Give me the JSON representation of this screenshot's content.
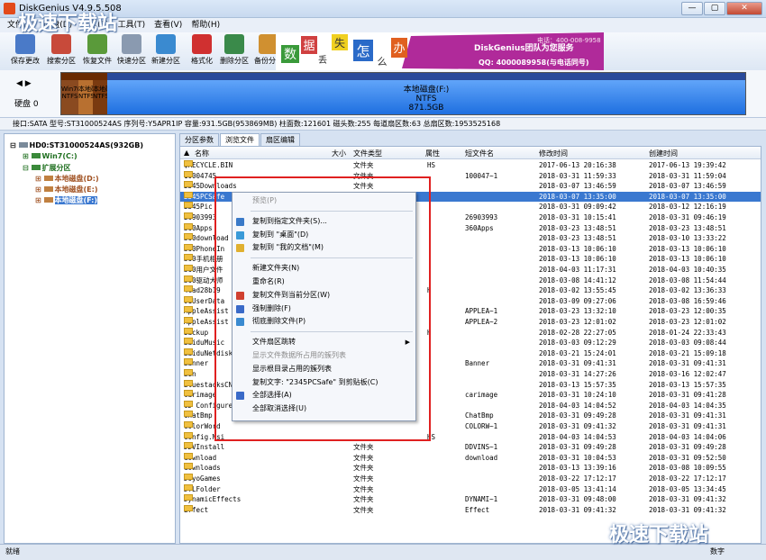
{
  "window": {
    "title": "DiskGenius V4.9.5.508",
    "buttons": [
      "—",
      "▢",
      "✕"
    ]
  },
  "menu": [
    "文件(F)",
    "硬盘(D)",
    "分区(P)",
    "工具(T)",
    "查看(V)",
    "帮助(H)"
  ],
  "toolbar": [
    {
      "label": "保存更改",
      "color": "#4a7ac8",
      "icon": "save-icon"
    },
    {
      "label": "搜索分区",
      "color": "#c84a3a",
      "icon": "search-icon"
    },
    {
      "label": "恢复文件",
      "color": "#5a9a3a",
      "icon": "recover-icon"
    },
    {
      "label": "快速分区",
      "color": "#8a9ab0",
      "icon": "partition-icon"
    },
    {
      "label": "新建分区",
      "color": "#3a8ad0",
      "icon": "new-partition-icon"
    },
    {
      "label": "格式化",
      "color": "#d03030",
      "icon": "format-icon"
    },
    {
      "label": "删除分区",
      "color": "#3a8a4a",
      "icon": "delete-partition-icon"
    },
    {
      "label": "备份分区",
      "color": "#d09030",
      "icon": "backup-icon"
    }
  ],
  "banner": {
    "chars": [
      "数",
      "据",
      "丢",
      "失",
      "怎",
      "么",
      "办"
    ],
    "team": "DiskGenius团队为您服务",
    "phone": "电话：400-008-9958",
    "qq": "QQ: 4000089958(与电话同号)"
  },
  "disk": {
    "label": "硬盘 0",
    "nav": "◀ ▶",
    "segments": [
      {
        "name": "Win7(C:)",
        "fs": "NTFS",
        "color": "#8a4a20"
      },
      {
        "name": "本地磁盘",
        "fs": "NTFS",
        "color": "#b87030"
      },
      {
        "name": "本地磁盘",
        "fs": "NTFS",
        "color": "#7a3a10"
      },
      {
        "name": "本地磁盘(F:)",
        "fs": "NTFS",
        "size": "871.5GB",
        "color": "#1e6fe0"
      }
    ],
    "info": "接口:SATA  型号:ST31000524AS  序列号:Y5APR1IP  容量:931.5GB(953869MB)  柱面数:121601  磁头数:255  每道扇区数:63  总扇区数:1953525168"
  },
  "tree": [
    {
      "label": "HD0:ST31000524AS(932GB)",
      "color": "#000"
    },
    {
      "label": "Win7(C:)",
      "color": "#207020"
    },
    {
      "label": "扩展分区",
      "color": "#207020"
    },
    {
      "label": "本地磁盘(D:)",
      "color": "#a05020"
    },
    {
      "label": "本地磁盘(E:)",
      "color": "#a05020"
    },
    {
      "label": "本地磁盘(F:)",
      "color": "#a05020"
    }
  ],
  "tabs": [
    "分区参数",
    "浏览文件",
    "扇区编辑"
  ],
  "columns": [
    "名称",
    "大小",
    "文件类型",
    "属性",
    "短文件名",
    "修改时间",
    "创建时间"
  ],
  "files": [
    {
      "name": "$RECYCLE.BIN",
      "type": "文件夹",
      "attr": "HS",
      "short": "",
      "mod": "2017-06-13 20:16:38",
      "cre": "2017-06-13 19:39:42"
    },
    {
      "name": "10004745",
      "type": "文件夹",
      "attr": "",
      "short": "100047~1",
      "mod": "2018-03-31 11:59:33",
      "cre": "2018-03-31 11:59:04"
    },
    {
      "name": "2345Downloads",
      "type": "文件夹",
      "attr": "",
      "short": "",
      "mod": "2018-03-07 13:46:59",
      "cre": "2018-03-07 13:46:59"
    },
    {
      "name": "2345PCSafe",
      "type": "",
      "attr": "",
      "short": "",
      "mod": "2018-03-07 13:35:00",
      "cre": "2018-03-07 13:35:00"
    },
    {
      "name": "2345Pic",
      "type": "",
      "attr": "",
      "short": "",
      "mod": "2018-03-31 09:09:42",
      "cre": "2018-03-12 12:16:19"
    },
    {
      "name": "26903993",
      "type": "",
      "attr": "",
      "short": "26903993",
      "mod": "2018-03-31 10:15:41",
      "cre": "2018-03-31 09:46:19"
    },
    {
      "name": "360Apps",
      "type": "",
      "attr": "",
      "short": "360Apps",
      "mod": "2018-03-23 13:48:51",
      "cre": "2018-03-23 13:48:51"
    },
    {
      "name": "360download",
      "type": "",
      "attr": "",
      "short": "",
      "mod": "2018-03-23 13:48:51",
      "cre": "2018-03-10 13:33:22"
    },
    {
      "name": "360PhoneIn",
      "type": "",
      "attr": "",
      "short": "",
      "mod": "2018-03-13 10:06:10",
      "cre": "2018-03-13 10:06:10"
    },
    {
      "name": "360手机相册",
      "type": "",
      "attr": "",
      "short": "",
      "mod": "2018-03-13 10:06:10",
      "cre": "2018-03-13 10:06:10"
    },
    {
      "name": "360用户文件",
      "type": "",
      "attr": "",
      "short": "",
      "mod": "2018-04-03 11:17:31",
      "cre": "2018-04-03 10:40:35"
    },
    {
      "name": "360驱动大师",
      "type": "",
      "attr": "",
      "short": "",
      "mod": "2018-03-08 14:41:12",
      "cre": "2018-03-08 11:54:44"
    },
    {
      "name": "4cad28b19",
      "type": "",
      "attr": "H",
      "short": "",
      "mod": "2018-03-02 13:55:45",
      "cre": "2018-03-02 13:36:33"
    },
    {
      "name": "91UserData",
      "type": "",
      "attr": "",
      "short": "",
      "mod": "2018-03-09 09:27:06",
      "cre": "2018-03-08 16:59:46"
    },
    {
      "name": "AppleAssist",
      "type": "",
      "attr": "",
      "short": "APPLEA~1",
      "mod": "2018-03-23 13:32:10",
      "cre": "2018-03-23 12:00:35"
    },
    {
      "name": "AppleAssist",
      "type": "",
      "attr": "",
      "short": "APPLEA~2",
      "mod": "2018-03-23 12:01:02",
      "cre": "2018-03-23 12:01:02"
    },
    {
      "name": "backup",
      "type": "",
      "attr": "H",
      "short": "",
      "mod": "2018-02-28 22:27:05",
      "cre": "2018-01-24 22:33:43"
    },
    {
      "name": "BaiduMusic",
      "type": "",
      "attr": "",
      "short": "",
      "mod": "2018-03-03 09:12:29",
      "cre": "2018-03-03 09:08:44"
    },
    {
      "name": "BaiduNetdisk",
      "type": "",
      "attr": "",
      "short": "",
      "mod": "2018-03-21 15:24:01",
      "cre": "2018-03-21 15:09:18"
    },
    {
      "name": "Banner",
      "type": "",
      "attr": "",
      "short": "Banner",
      "mod": "2018-03-31 09:41:31",
      "cre": "2018-03-31 09:41:31"
    },
    {
      "name": "Bin",
      "type": "",
      "attr": "",
      "short": "",
      "mod": "2018-03-31 14:27:26",
      "cre": "2018-03-16 12:02:47"
    },
    {
      "name": "BluestacksCN",
      "type": "",
      "attr": "",
      "short": "",
      "mod": "2018-03-13 15:57:35",
      "cre": "2018-03-13 15:57:35"
    },
    {
      "name": "carimage",
      "type": "",
      "attr": "",
      "short": "carimage",
      "mod": "2018-03-31 10:24:10",
      "cre": "2018-03-31 09:41:28"
    },
    {
      "name": "CD Configure",
      "type": "",
      "attr": "",
      "short": "",
      "mod": "2018-04-03 14:04:52",
      "cre": "2018-04-03 14:04:35"
    },
    {
      "name": "ChatBmp",
      "type": "",
      "attr": "",
      "short": "ChatBmp",
      "mod": "2018-03-31 09:49:28",
      "cre": "2018-03-31 09:41:31"
    },
    {
      "name": "ColorWord",
      "type": "",
      "attr": "",
      "short": "COLORW~1",
      "mod": "2018-03-31 09:41:32",
      "cre": "2018-03-31 09:41:31"
    },
    {
      "name": "Config.Msi",
      "type": "",
      "attr": "HS",
      "short": "",
      "mod": "2018-04-03 14:04:53",
      "cre": "2018-04-03 14:04:06"
    },
    {
      "name": "DDVInstall",
      "type": "文件夹",
      "attr": "",
      "short": "DDVINS~1",
      "mod": "2018-03-31 09:49:28",
      "cre": "2018-03-31 09:49:28"
    },
    {
      "name": "download",
      "type": "文件夹",
      "attr": "",
      "short": "download",
      "mod": "2018-03-31 10:04:53",
      "cre": "2018-03-31 09:52:50"
    },
    {
      "name": "downloads",
      "type": "文件夹",
      "attr": "",
      "short": "",
      "mod": "2018-03-13 13:39:16",
      "cre": "2018-03-08 10:09:55"
    },
    {
      "name": "DoyoGames",
      "type": "文件夹",
      "attr": "",
      "short": "",
      "mod": "2018-03-22 17:12:17",
      "cre": "2018-03-22 17:12:17"
    },
    {
      "name": "DTLFolder",
      "type": "文件夹",
      "attr": "",
      "short": "",
      "mod": "2018-03-05 13:41:14",
      "cre": "2018-03-05 13:34:45"
    },
    {
      "name": "DynamicEffects",
      "type": "文件夹",
      "attr": "",
      "short": "DYNAMI~1",
      "mod": "2018-03-31 09:48:00",
      "cre": "2018-03-31 09:41:32"
    },
    {
      "name": "Effect",
      "type": "文件夹",
      "attr": "",
      "short": "Effect",
      "mod": "2018-03-31 09:41:32",
      "cre": "2018-03-31 09:41:32"
    }
  ],
  "context_menu": [
    {
      "label": "预览(P)",
      "disabled": true,
      "icon": ""
    },
    {
      "sep": true
    },
    {
      "label": "复制到指定文件夹(S)...",
      "icon": "#3a7ac8"
    },
    {
      "label": "复制到 \"桌面\"(D)",
      "icon": "#3a9ad8"
    },
    {
      "label": "复制到 \"我的文档\"(M)",
      "icon": "#e0b030"
    },
    {
      "sep": true
    },
    {
      "label": "新建文件夹(N)",
      "icon": ""
    },
    {
      "label": "重命名(R)",
      "icon": ""
    },
    {
      "label": "复制文件到当前分区(W)",
      "icon": "#d04030"
    },
    {
      "label": "强制删除(F)",
      "icon": "#3a6ac8"
    },
    {
      "label": "彻底删除文件(P)",
      "icon": "#3a8ad0"
    },
    {
      "sep": true
    },
    {
      "label": "文件扇区跳转",
      "icon": "",
      "submenu": true
    },
    {
      "label": "显示文件数据所占用的簇列表",
      "disabled": true,
      "icon": ""
    },
    {
      "label": "显示根目录占用的簇列表",
      "icon": ""
    },
    {
      "label": "复制文字: \"2345PCSafe\" 到剪贴板(C)",
      "icon": ""
    },
    {
      "label": "全部选择(A)",
      "icon": "#3a6ac8"
    },
    {
      "label": "全部取消选择(U)",
      "icon": ""
    }
  ],
  "status": {
    "left": "就绪",
    "right": "数字"
  },
  "watermark": "极速下载站"
}
